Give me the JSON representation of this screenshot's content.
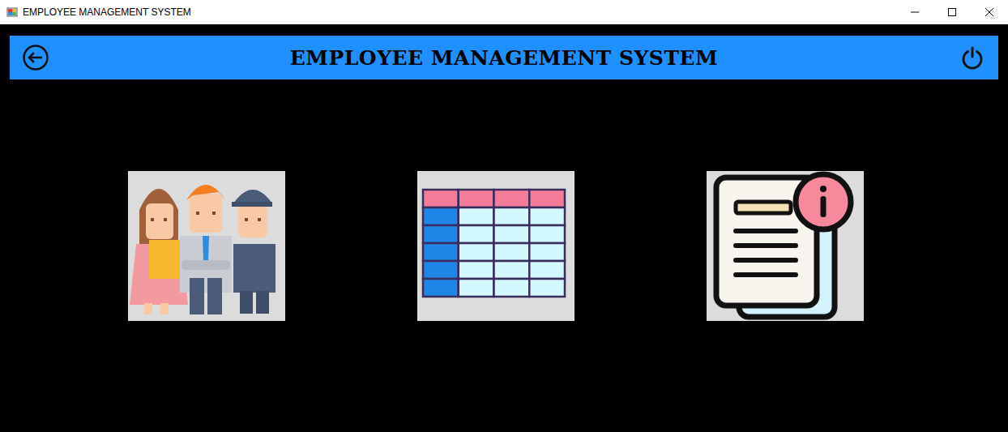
{
  "window": {
    "title": "EMPLOYEE MANAGEMENT SYSTEM"
  },
  "header": {
    "title": "EMPLOYEE MANAGEMENT SYSTEM"
  }
}
